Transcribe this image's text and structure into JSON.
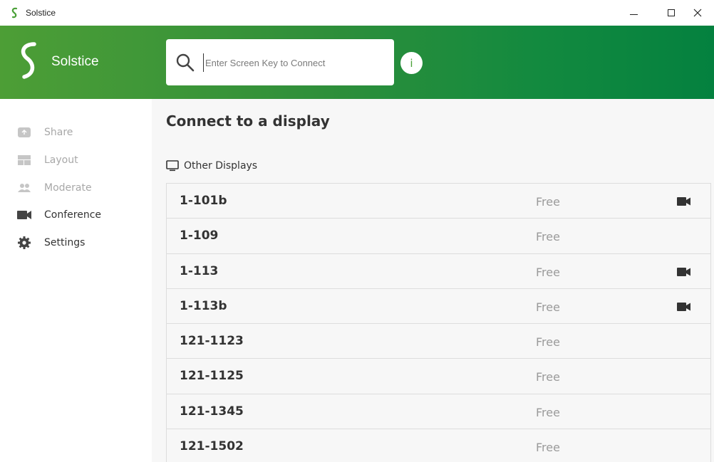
{
  "window": {
    "title": "Solstice"
  },
  "header": {
    "brand": "Solstice",
    "search_placeholder": "Enter Screen Key to Connect",
    "info_label": "i"
  },
  "sidebar": {
    "items": [
      {
        "label": "Share",
        "icon": "share-icon",
        "enabled": false
      },
      {
        "label": "Layout",
        "icon": "layout-icon",
        "enabled": false
      },
      {
        "label": "Moderate",
        "icon": "moderate-icon",
        "enabled": false
      },
      {
        "label": "Conference",
        "icon": "video-camera-icon",
        "enabled": true
      },
      {
        "label": "Settings",
        "icon": "gear-icon",
        "enabled": true
      }
    ]
  },
  "main": {
    "title": "Connect to a display",
    "section_label": "Other Displays",
    "displays": [
      {
        "name": "1-101b",
        "status": "Free",
        "conference": true
      },
      {
        "name": "1-109",
        "status": "Free",
        "conference": false
      },
      {
        "name": "1-113",
        "status": "Free",
        "conference": true
      },
      {
        "name": "1-113b",
        "status": "Free",
        "conference": true
      },
      {
        "name": "121-1123",
        "status": "Free",
        "conference": false
      },
      {
        "name": "121-1125",
        "status": "Free",
        "conference": false
      },
      {
        "name": "121-1345",
        "status": "Free",
        "conference": false
      },
      {
        "name": "121-1502",
        "status": "Free",
        "conference": false
      }
    ]
  },
  "colors": {
    "brand_green": "#4aa038",
    "header_gradient_start": "#4d9e36",
    "header_gradient_end": "#04813f",
    "disabled_text": "#a8a8a8",
    "status_text": "#9a9a9a"
  }
}
